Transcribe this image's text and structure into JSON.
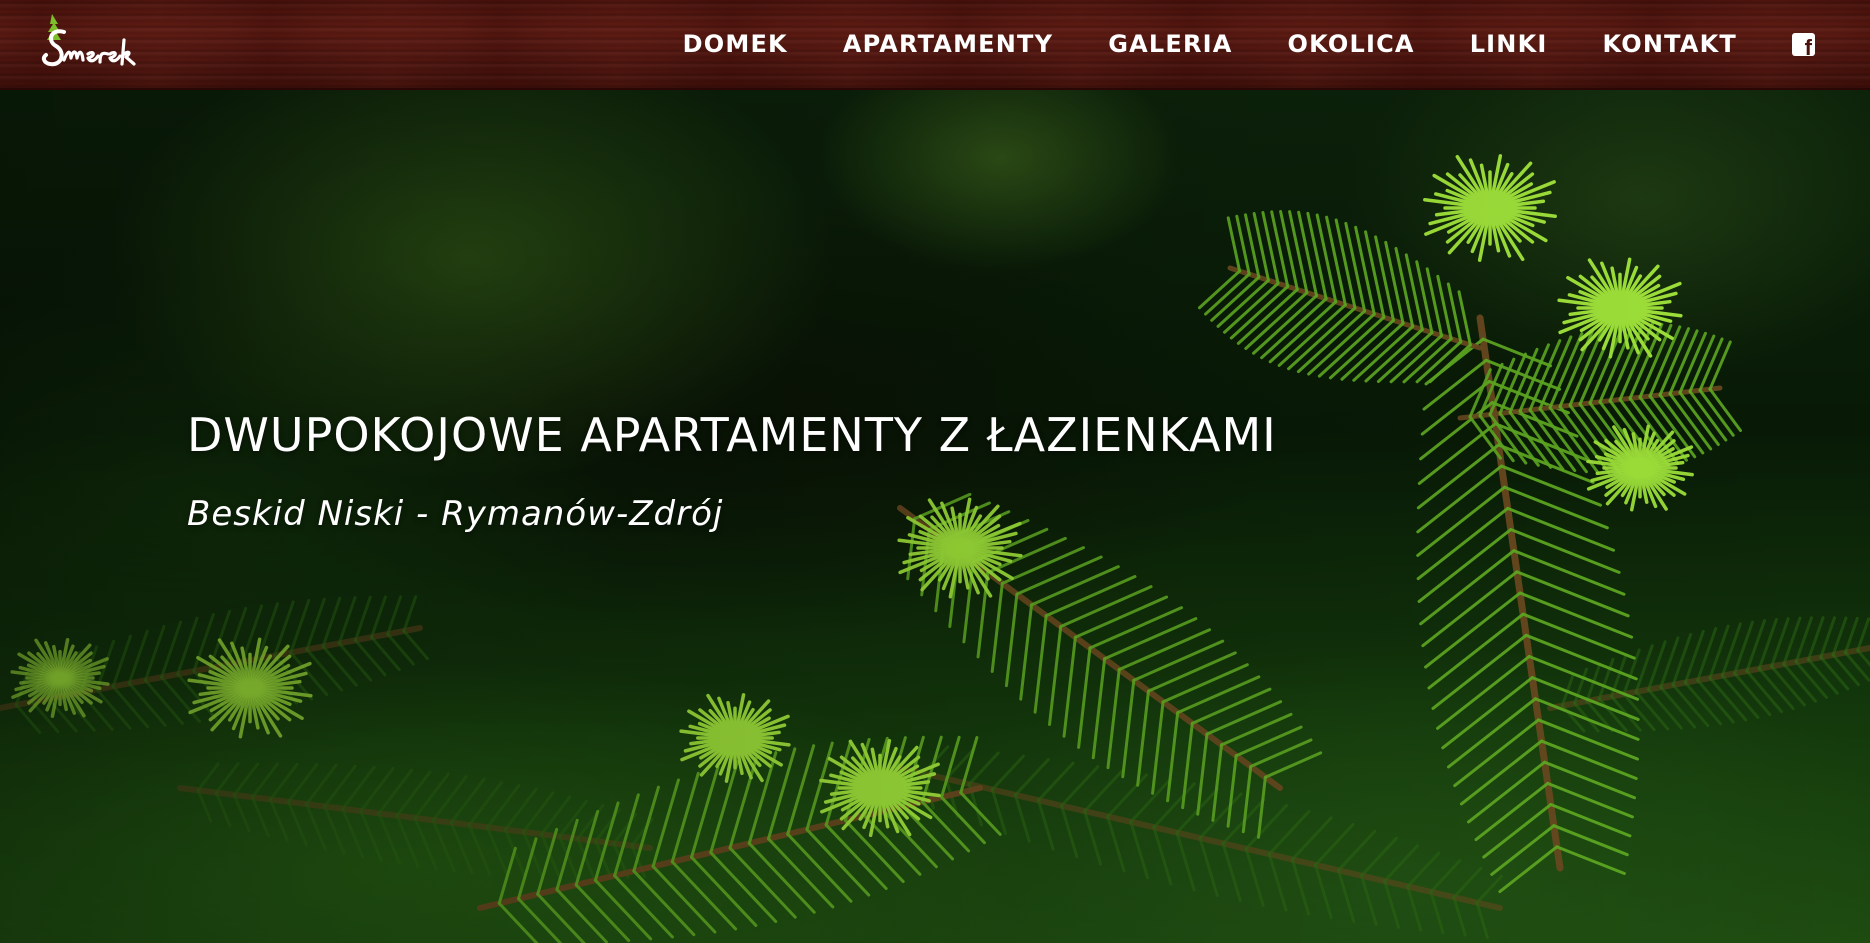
{
  "header": {
    "logo_text": "Smerek",
    "nav": [
      {
        "label": "DOMEK"
      },
      {
        "label": "APARTAMENTY"
      },
      {
        "label": "GALERIA"
      },
      {
        "label": "OKOLICA"
      },
      {
        "label": "LINKI"
      },
      {
        "label": "KONTAKT"
      }
    ],
    "social_icon": "facebook-icon",
    "colors": {
      "wood_dark": "#3e0f09",
      "wood_mid": "#5c1a12",
      "text": "#ffffff"
    }
  },
  "hero": {
    "title": "DWUPOKOJOWE APARTAMENTY Z ŁAZIENKAMI",
    "subtitle": "Beskid Niski - Rymanów-Zdrój",
    "background": "spruce-branches-photo",
    "colors": {
      "needle_light": "#9fe23a",
      "needle_mid": "#5faa22",
      "needle_dark": "#2d6a14",
      "stem": "#6b4a20"
    }
  }
}
